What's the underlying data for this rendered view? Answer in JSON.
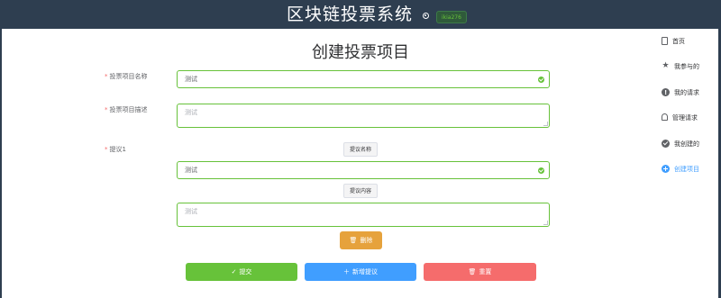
{
  "header": {
    "title": "区块链投票系统",
    "user": "ikia276"
  },
  "form": {
    "page_title": "创建投票项目",
    "name_label": "投票项目名称",
    "name_value": "测试",
    "desc_label": "投票项目描述",
    "desc_placeholder": "测试",
    "proposal_label": "提议1",
    "proposal_name_btn": "提议名称",
    "proposal_name_value": "测试",
    "proposal_content_btn": "提议内容",
    "proposal_content_value": "测试",
    "delete_label": "删除",
    "required_mark": "*"
  },
  "actions": {
    "submit": "提交",
    "add": "新增提议",
    "reset": "重置"
  },
  "sidebar": {
    "items": [
      {
        "label": "首页",
        "icon": "document-icon"
      },
      {
        "label": "我参与的",
        "icon": "star-icon"
      },
      {
        "label": "我的请求",
        "icon": "warning-icon"
      },
      {
        "label": "管理请求",
        "icon": "bell-icon"
      },
      {
        "label": "我创建的",
        "icon": "check-circle-icon"
      },
      {
        "label": "创建项目",
        "icon": "plus-circle-icon"
      }
    ],
    "active_index": 5
  },
  "colors": {
    "header_bg": "#2e3e50",
    "success": "#67c23a",
    "primary": "#409eff",
    "warning": "#e6a23c",
    "danger": "#f56c6c"
  }
}
